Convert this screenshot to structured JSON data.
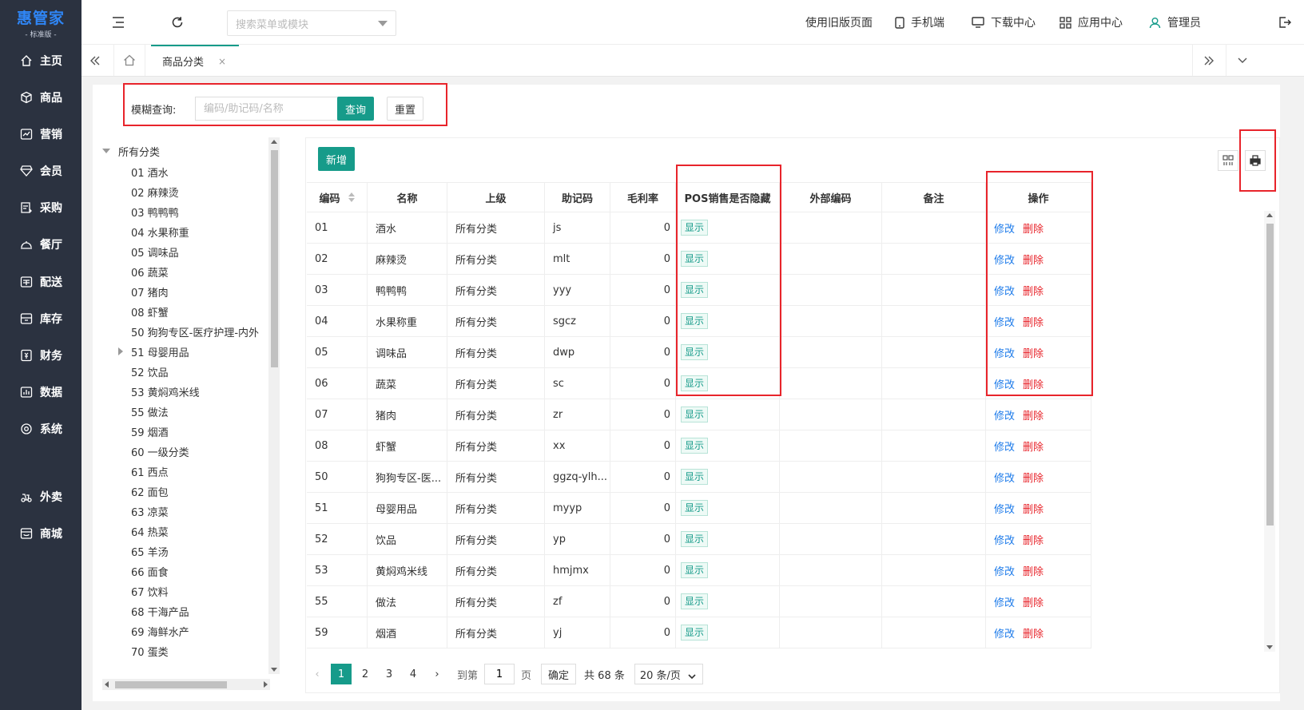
{
  "app": {
    "logo_main": "惠管家",
    "logo_sub": "- 标准版 -"
  },
  "sidebar": {
    "items": [
      {
        "label": "主页",
        "icon": "home-icon"
      },
      {
        "label": "商品",
        "icon": "box-icon"
      },
      {
        "label": "营销",
        "icon": "chart-icon"
      },
      {
        "label": "会员",
        "icon": "diamond-icon"
      },
      {
        "label": "采购",
        "icon": "purchase-icon"
      },
      {
        "label": "餐厅",
        "icon": "restaurant-icon"
      },
      {
        "label": "配送",
        "icon": "delivery-icon"
      },
      {
        "label": "库存",
        "icon": "inventory-icon"
      },
      {
        "label": "财务",
        "icon": "finance-icon"
      },
      {
        "label": "数据",
        "icon": "data-icon"
      },
      {
        "label": "系统",
        "icon": "system-icon"
      },
      {
        "label": "外卖",
        "icon": "takeout-icon"
      },
      {
        "label": "商城",
        "icon": "mall-icon"
      }
    ]
  },
  "header": {
    "menu_search_placeholder": "搜索菜单或模块",
    "old_version": "使用旧版页面",
    "mobile": "手机端",
    "download": "下载中心",
    "apps": "应用中心",
    "admin": "管理员"
  },
  "tabs": {
    "active_label": "商品分类",
    "close": "×"
  },
  "query": {
    "label": "模糊查询:",
    "placeholder": "编码/助记码/名称",
    "search_btn": "查询",
    "reset_btn": "重置"
  },
  "tree": {
    "root": "所有分类",
    "items": [
      "01 酒水",
      "02 麻辣烫",
      "03 鸭鸭鸭",
      "04 水果称重",
      "05 调味品",
      "06 蔬菜",
      "07 猪肉",
      "08 虾蟹",
      "50 狗狗专区-医疗护理-内外",
      "51 母婴用品",
      "52 饮品",
      "53 黄焖鸡米线",
      "55 做法",
      "59 烟酒",
      "60 一级分类",
      "61 西点",
      "62 面包",
      "63 凉菜",
      "64 热菜",
      "65 羊汤",
      "66 面食",
      "67 饮料",
      "68 干海产品",
      "69 海鲜水产",
      "70 蛋类"
    ]
  },
  "table": {
    "add_btn": "新增",
    "columns": [
      "编码",
      "名称",
      "上级",
      "助记码",
      "毛利率",
      "POS销售是否隐藏",
      "外部编码",
      "备注",
      "操作"
    ],
    "show_tag": "显示",
    "edit": "修改",
    "delete": "删除",
    "rows": [
      {
        "code": "01",
        "name": "酒水",
        "parent": "所有分类",
        "mnemonic": "js",
        "margin": "0"
      },
      {
        "code": "02",
        "name": "麻辣烫",
        "parent": "所有分类",
        "mnemonic": "mlt",
        "margin": "0"
      },
      {
        "code": "03",
        "name": "鸭鸭鸭",
        "parent": "所有分类",
        "mnemonic": "yyy",
        "margin": "0"
      },
      {
        "code": "04",
        "name": "水果称重",
        "parent": "所有分类",
        "mnemonic": "sgcz",
        "margin": "0"
      },
      {
        "code": "05",
        "name": "调味品",
        "parent": "所有分类",
        "mnemonic": "dwp",
        "margin": "0"
      },
      {
        "code": "06",
        "name": "蔬菜",
        "parent": "所有分类",
        "mnemonic": "sc",
        "margin": "0"
      },
      {
        "code": "07",
        "name": "猪肉",
        "parent": "所有分类",
        "mnemonic": "zr",
        "margin": "0"
      },
      {
        "code": "08",
        "name": "虾蟹",
        "parent": "所有分类",
        "mnemonic": "xx",
        "margin": "0"
      },
      {
        "code": "50",
        "name": "狗狗专区-医...",
        "parent": "所有分类",
        "mnemonic": "ggzq-ylh...",
        "margin": "0"
      },
      {
        "code": "51",
        "name": "母婴用品",
        "parent": "所有分类",
        "mnemonic": "myyp",
        "margin": "0"
      },
      {
        "code": "52",
        "name": "饮品",
        "parent": "所有分类",
        "mnemonic": "yp",
        "margin": "0"
      },
      {
        "code": "53",
        "name": "黄焖鸡米线",
        "parent": "所有分类",
        "mnemonic": "hmjmx",
        "margin": "0"
      },
      {
        "code": "55",
        "name": "做法",
        "parent": "所有分类",
        "mnemonic": "zf",
        "margin": "0"
      },
      {
        "code": "59",
        "name": "烟酒",
        "parent": "所有分类",
        "mnemonic": "yj",
        "margin": "0"
      }
    ]
  },
  "pager": {
    "pages": [
      "1",
      "2",
      "3",
      "4"
    ],
    "goto_label": "到第",
    "goto_value": "1",
    "page_unit": "页",
    "confirm": "确定",
    "total": "共 68 条",
    "page_size": "20 条/页"
  },
  "colors": {
    "sidebar_bg": "#2b3240",
    "accent": "#169b8a",
    "highlight_box": "#e8242b",
    "link_blue": "#1d7bea"
  }
}
